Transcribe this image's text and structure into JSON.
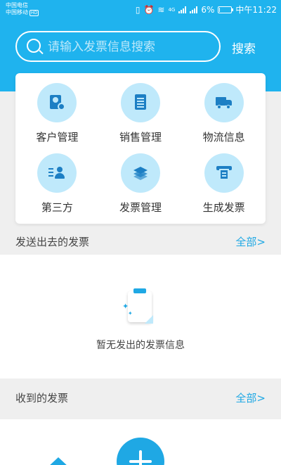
{
  "status_bar": {
    "carrier1": "中国电信",
    "carrier2": "中国移动",
    "hd_badge": "HD",
    "network": "4G",
    "battery_text": "6%",
    "battery_level": 0.06,
    "time": "中午11:22"
  },
  "search": {
    "placeholder": "请输入发票信息搜索",
    "button_label": "搜索"
  },
  "menu": {
    "items": [
      {
        "label": "客户管理",
        "icon": "customer-add-icon"
      },
      {
        "label": "销售管理",
        "icon": "document-icon"
      },
      {
        "label": "物流信息",
        "icon": "truck-icon"
      },
      {
        "label": "第三方",
        "icon": "contact-list-icon"
      },
      {
        "label": "发票管理",
        "icon": "layers-icon"
      },
      {
        "label": "生成发票",
        "icon": "printer-icon"
      }
    ]
  },
  "sent_section": {
    "title": "发送出去的发票",
    "more_label": "全部>",
    "empty_text": "暂无发出的发票信息"
  },
  "received_section": {
    "title": "收到的发票",
    "more_label": "全部>"
  },
  "colors": {
    "header_blue": "#1fb3ee",
    "accent_blue": "#1fa8e4",
    "icon_circle": "#bfe9fb",
    "icon_fg": "#1d7fc4"
  }
}
